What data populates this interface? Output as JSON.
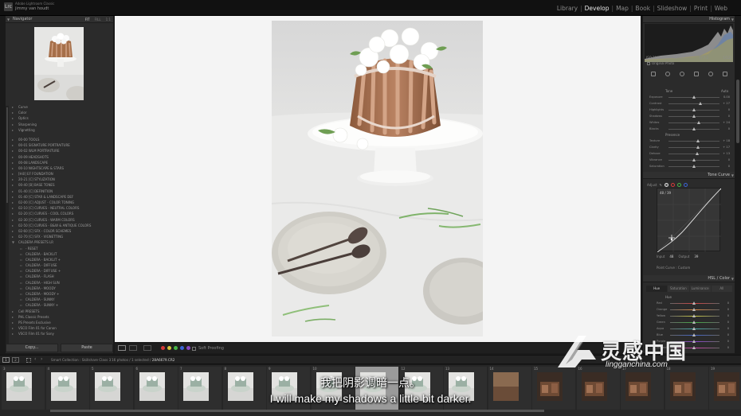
{
  "app": {
    "product": "Adobe Lightroom Classic",
    "user": "jimmy van houdt",
    "logo": "Lrc"
  },
  "modules": [
    "Library",
    "Develop",
    "Map",
    "Book",
    "Slideshow",
    "Print",
    "Web"
  ],
  "active_module": "Develop",
  "navigator": {
    "title": "Navigator",
    "zoom_options": [
      "FIT",
      "FILL",
      "1:1"
    ]
  },
  "left_panel": {
    "top_items": [
      "Curve",
      "Color",
      "Optics",
      "Sharpening",
      "Vignetting"
    ],
    "presets": [
      "00-00 TOOLS",
      "00-01 SIGNATURE PORTRAITURE",
      "00-02 WLM PORTRAITURE",
      "00-09 HEADSHOTS",
      "00-08 LANDSCAPE",
      "00-10 NIGHTSCAPE & STARS",
      "[Hi0] EF FOUNDATION",
      "20-21 [C] STYLIZATION",
      "00-40 [B] BASE TONES",
      "01-40 [C] DEFINITION",
      "01-40 [C] STAR & LANDSCAPE DEF",
      "02-00 [C] ADJUST - COLOR TONING",
      "02-10 [C] CURVES - NEUTRAL COLORS",
      "02-20 [C] CURVES - COOL COLORS",
      "02-30 [C] CURVES - WARM COLORS",
      "02-50 [C] CURVES - B&W & ANTIQUE COLORS",
      "02-60 [C] SFX - COLOR SCHEMES",
      "02-70 [C] SFX - VIGNETTING",
      "CALDERA PRESETS LR"
    ],
    "caldera_items": [
      "- RESET",
      "CALDERA - BACKLIT",
      "CALDERA - BACKLIT +",
      "CALDERA - DIFFUSE",
      "CALDERA - DIFFUSE +",
      "CALDERA - FLASH",
      "CALDERA - HIGH SUN",
      "CALDERA - MOODY",
      "CALDERA - MOODY +",
      "CALDERA - SUNNY",
      "CALDERA - SUNNY +"
    ],
    "bottom_presets": [
      "Cell PRESETS",
      "PHL Classic Presets",
      "PS Presets Exclusive",
      "VSCO Film 01 for Canon",
      "VSCO Film 01 for Sony"
    ],
    "copy_label": "Copy...",
    "paste_label": "Paste"
  },
  "toolbar": {
    "soft_proofing": "Soft Proofing",
    "label_colors": [
      "#d63a3a",
      "#d6c43a",
      "#46b646",
      "#3a64d6",
      "#8a46c6"
    ]
  },
  "right_panel": {
    "histogram_title": "Histogram",
    "histogram_readout": [
      "ISO 200",
      "50 mm",
      "f / 7.1",
      "1/125"
    ],
    "original_photo": "Original Photo",
    "tone_title": "Tone",
    "tone_auto": "Auto",
    "basic_rows": [
      {
        "label": "Exposure",
        "value": "0.00",
        "pos": 0.5
      },
      {
        "label": "Contrast",
        "value": "+ 27",
        "pos": 0.62
      },
      {
        "label": "Highlights",
        "value": "0",
        "pos": 0.5
      },
      {
        "label": "Shadows",
        "value": "0",
        "pos": 0.5
      },
      {
        "label": "Whites",
        "value": "+ 24",
        "pos": 0.6
      },
      {
        "label": "Blacks",
        "value": "0",
        "pos": 0.5
      }
    ],
    "presence_title": "Presence",
    "presence_rows": [
      {
        "label": "Texture",
        "value": "+ 18",
        "pos": 0.58
      },
      {
        "label": "Clarity",
        "value": "+ 17",
        "pos": 0.58
      },
      {
        "label": "Dehaze",
        "value": "+ 13",
        "pos": 0.56
      }
    ],
    "vibrance_rows": [
      {
        "label": "Vibrance",
        "value": "0",
        "pos": 0.5
      },
      {
        "label": "Saturation",
        "value": "0",
        "pos": 0.5
      }
    ],
    "tone_curve_title": "Tone Curve",
    "channel_label": "Adjust",
    "channel_colors": [
      "#ffffff",
      "#d63a3a",
      "#46b646",
      "#3a64d6"
    ],
    "curve_readout": "48 / 39",
    "input_label": "Input",
    "input_value": "48",
    "output_label": "Output",
    "output_value": "39",
    "point_curve": "Point Curve : Custom",
    "hsl_title": "HSL / Color",
    "hsl_tabs": [
      "Hue",
      "Saturation",
      "Luminance",
      "All"
    ],
    "hsl_active": "Hue",
    "hsl_section": "Hue",
    "hsl_rows": [
      {
        "label": "Red",
        "value": "0",
        "color": "#c44"
      },
      {
        "label": "Orange",
        "value": "0",
        "color": "#d84"
      },
      {
        "label": "Yellow",
        "value": "0",
        "color": "#cc4"
      },
      {
        "label": "Green",
        "value": "0",
        "color": "#4a4"
      },
      {
        "label": "Aqua",
        "value": "0",
        "color": "#4aa"
      },
      {
        "label": "Blue",
        "value": "0",
        "color": "#46c"
      },
      {
        "label": "Purple",
        "value": "0",
        "color": "#84c"
      },
      {
        "label": "Magenta",
        "value": "0",
        "color": "#c4a"
      }
    ]
  },
  "filmbar": {
    "source": "Smart Collection : Skillshare Class 3",
    "count_prefix": "16 photos / 1 selected /",
    "filename": "28A6679.CR2"
  },
  "filmstrip": {
    "numbers": [
      "3",
      "4",
      "5",
      "6",
      "7",
      "8",
      "9",
      "10",
      "11",
      "12",
      "13",
      "14",
      "15",
      "16",
      "17",
      "18",
      "19"
    ],
    "selected_index": 8
  },
  "subtitles": {
    "cn": "我把阴影调暗一点。",
    "en": "I will make my shadows a little bit darker."
  },
  "watermark": {
    "cn": "灵感中国",
    "en": "lingganchina.com"
  }
}
